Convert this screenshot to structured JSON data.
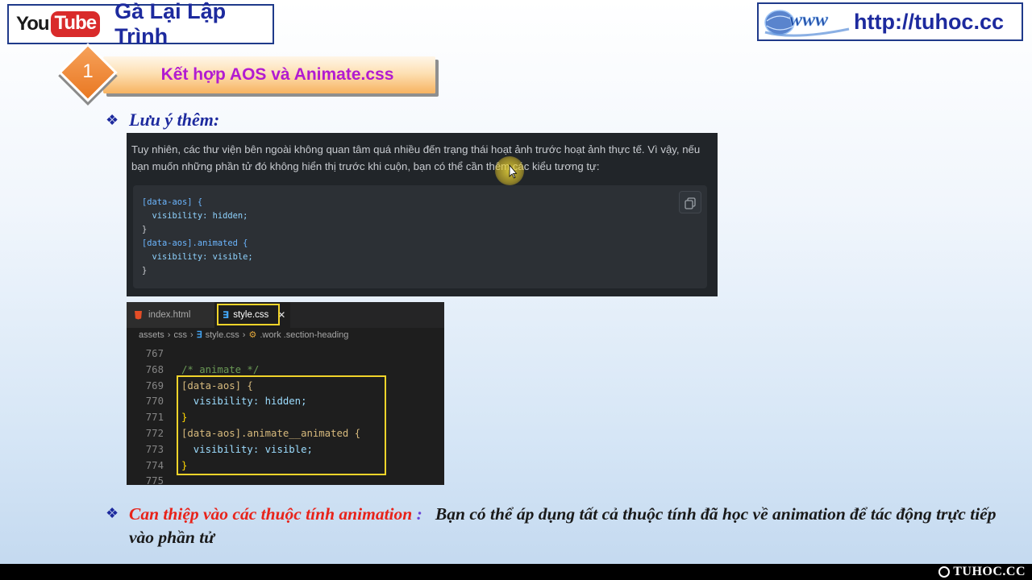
{
  "header": {
    "youtube_you": "You",
    "youtube_tube": "Tube",
    "channel_name": "Gà Lại Lập Trình",
    "url": "http://tuhoc.cc",
    "www_logo_text": "www"
  },
  "section": {
    "number": "1",
    "title": "Kết hợp AOS và Animate.css"
  },
  "note": {
    "bullet": "❖",
    "heading": "Lưu ý thêm:"
  },
  "doc_panel": {
    "paragraph": "Tuy nhiên, các thư viện bên ngoài không quan tâm quá nhiều đến trạng thái hoạt ảnh trước hoạt ảnh thực tế. Vì vậy, nếu bạn muốn những phần tử đó không hiển thị trước khi cuộn, bạn có thể cần thêm các kiểu tương tự:",
    "code_lines": [
      "[data-aos] {",
      "  visibility: hidden;",
      "}",
      "[data-aos].animated {",
      "  visibility: visible;",
      "}"
    ]
  },
  "editor": {
    "tabs": [
      {
        "label": "index.html",
        "icon": "html5-icon"
      },
      {
        "label": "style.css",
        "icon": "css3-icon",
        "active": true
      }
    ],
    "breadcrumb": [
      "assets",
      "css",
      "style.css",
      ".work .section-heading"
    ],
    "lines": [
      {
        "num": "767",
        "text": ""
      },
      {
        "num": "768",
        "text": "/* animate */"
      },
      {
        "num": "769",
        "text": "[data-aos] {"
      },
      {
        "num": "770",
        "text": "  visibility: hidden;"
      },
      {
        "num": "771",
        "text": "}"
      },
      {
        "num": "772",
        "text": "[data-aos].animate__animated {"
      },
      {
        "num": "773",
        "text": "  visibility: visible;"
      },
      {
        "num": "774",
        "text": "}"
      },
      {
        "num": "775",
        "text": ""
      }
    ]
  },
  "bottom_note": {
    "bullet": "❖",
    "highlight": "Can thiệp vào các thuộc tính animation",
    "colon": ":",
    "text": "Bạn có thể áp dụng tất cả thuộc tính đã học về animation để tác động trực tiếp vào phần tử"
  },
  "watermark": "TUHOC.CC",
  "colors": {
    "navy": "#1d2a9e",
    "section_title": "#b21bd1",
    "diamond": "#e97822",
    "highlight_red": "#e8231a",
    "outline_yellow": "#f2d42a"
  }
}
